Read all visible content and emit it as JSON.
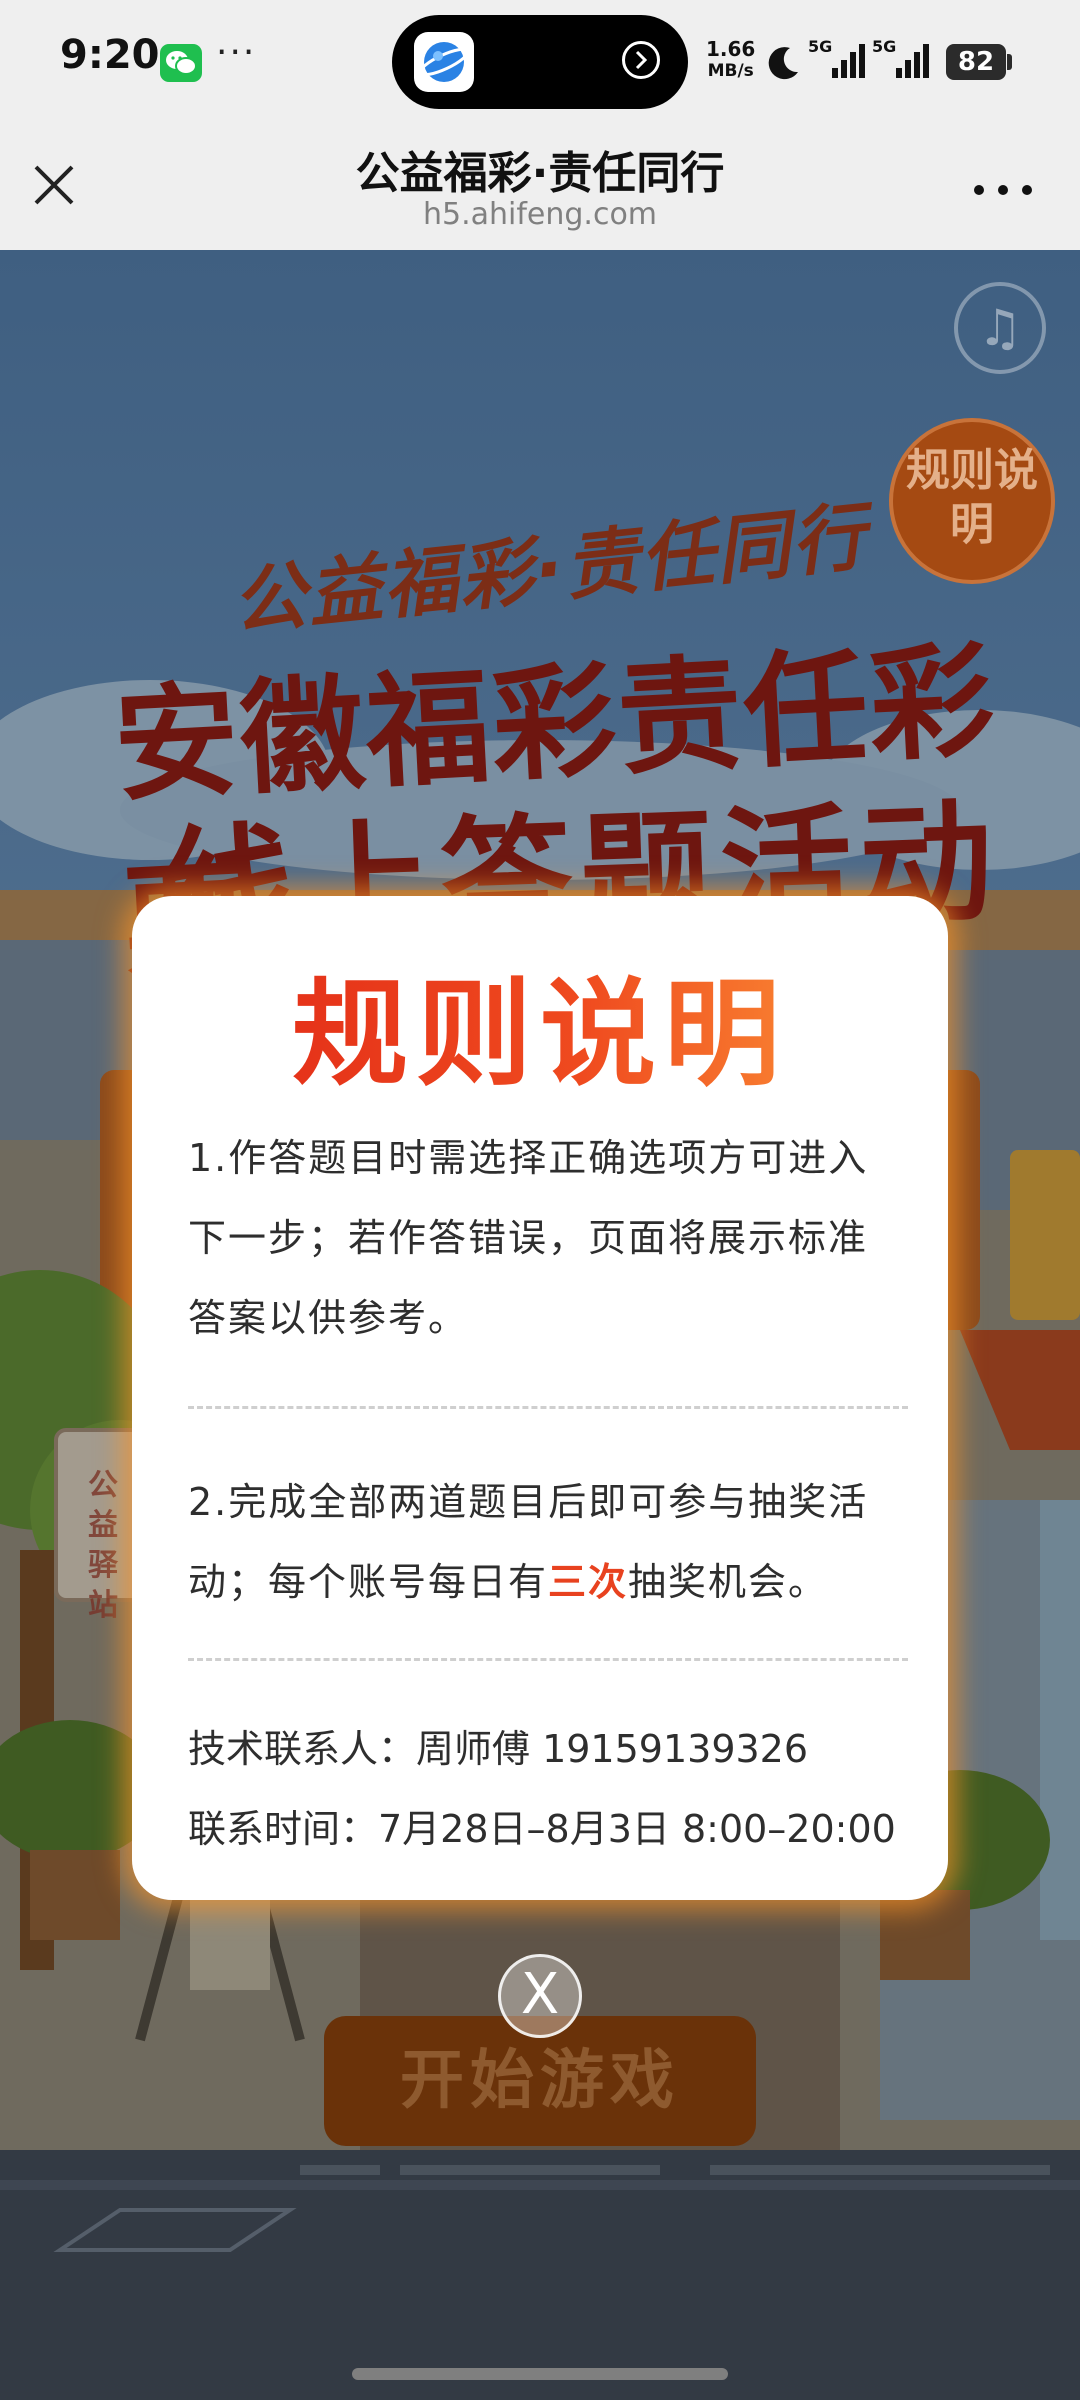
{
  "status_bar": {
    "time": "9:20",
    "more": "···",
    "net_speed_value": "1.66",
    "net_speed_unit": "MB/s",
    "signal_1_label": "5G",
    "signal_2_label": "5G",
    "battery": "82"
  },
  "header": {
    "title": "公益福彩·责任同行",
    "url": "h5.ahifeng.com"
  },
  "game": {
    "music_icon": "♫",
    "rules_badge": "规则说明",
    "banner_sub": "公益福彩·责任同行",
    "banner_main": "安徽福彩责任彩票",
    "banner_main2": "线上答题活动",
    "sign_text": "公益驿站",
    "start_button": "开始游戏"
  },
  "modal": {
    "title": "规则说明",
    "rule1": "1.作答题目时需选择正确选项方可进入下一步；若作答错误，页面将展示标准答案以供参考。",
    "rule2_before": "2.完成全部两道题目后即可参与抽奖活动；每个账号每日有",
    "rule2_highlight": "三次",
    "rule2_after": "抽奖机会。",
    "contact_person": "技术联系人：周师傅 19159139326",
    "contact_time": "联系时间：7月28日–8月3日 8:00–20:00",
    "close_label": "X",
    "highlight_color": "#e8421f"
  }
}
